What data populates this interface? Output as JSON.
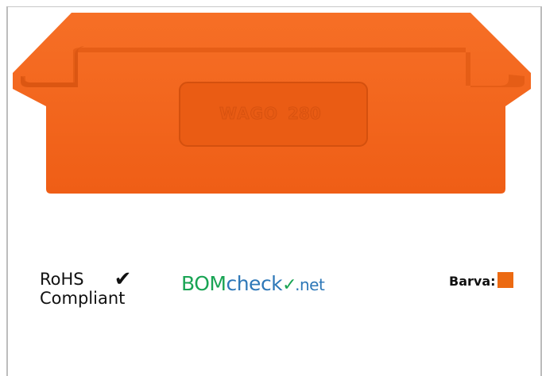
{
  "product": {
    "brand_mark": "WAGO",
    "model_mark": "280",
    "part_color": "#f2641e"
  },
  "compliance": {
    "rohs_line1": "RoHS",
    "rohs_line2": "Compliant",
    "check_icon": "checkmark-icon",
    "bomcheck_part1": "BOM",
    "bomcheck_part2": "check",
    "bomcheck_part3": ".net"
  },
  "color_info": {
    "label": "Barva:",
    "swatch_color": "#ec6a12"
  }
}
